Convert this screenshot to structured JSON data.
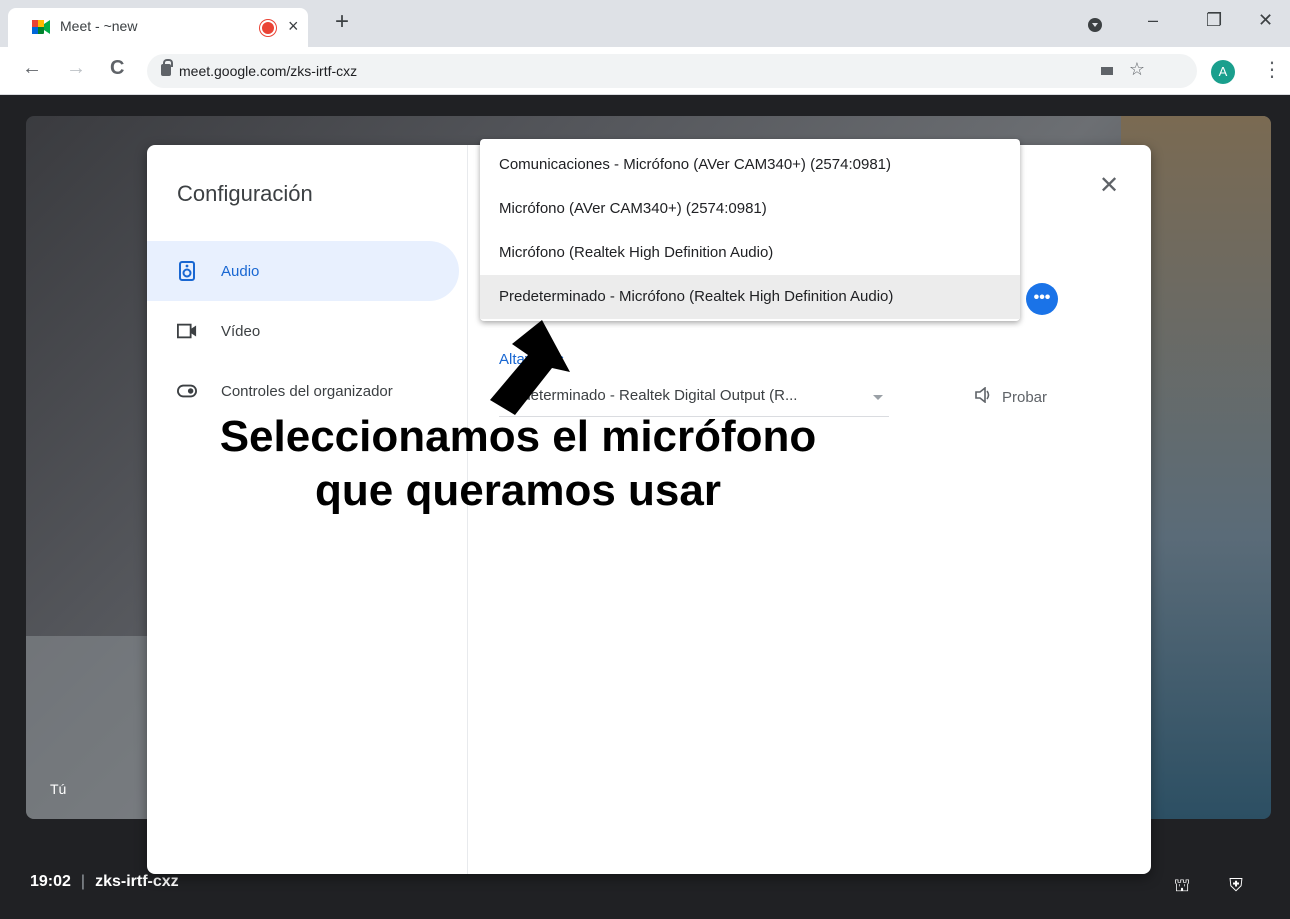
{
  "browser": {
    "tab_title": "Meet - ~new",
    "url": "meet.google.com/zks-irtf-cxz",
    "avatar_letter": "A",
    "new_tab": "+",
    "tab_close": "×",
    "win_minimize": "–",
    "win_restore": "❐",
    "win_close": "✕",
    "back": "←",
    "forward": "→",
    "reload": "C",
    "bookmark_star": "☆",
    "menu": "⋮"
  },
  "meeting": {
    "self_label": "Tú",
    "time": "19:02",
    "separator": "|",
    "meeting_code": "zks-irtf-cxz",
    "record_color": "#ea4335"
  },
  "dialog": {
    "title": "Configuración",
    "close": "✕",
    "nav": [
      {
        "label": "Audio",
        "icon": "speaker-icon",
        "active": true
      },
      {
        "label": "Vídeo",
        "icon": "video-camera-icon",
        "active": false
      },
      {
        "label": "Controles del organizador",
        "icon": "toggle-icon",
        "active": false
      }
    ],
    "speakers_label": "Altavoces",
    "speaker_value": "Predeterminado - Realtek Digital Output (R...",
    "test_label": "Probar",
    "more_button": "•••",
    "accent_color": "#1a73e8"
  },
  "mic_menu": {
    "options": [
      "Comunicaciones - Micrófono (AVer CAM340+) (2574:0981)",
      "Micrófono (AVer CAM340+) (2574:0981)",
      "Micrófono (Realtek High Definition Audio)",
      "Predeterminado - Micrófono (Realtek High Definition Audio)"
    ],
    "selected_index": 3
  },
  "annotation": {
    "text_line1": "Seleccionamos el micrófono",
    "text_line2": "que queramos usar"
  }
}
